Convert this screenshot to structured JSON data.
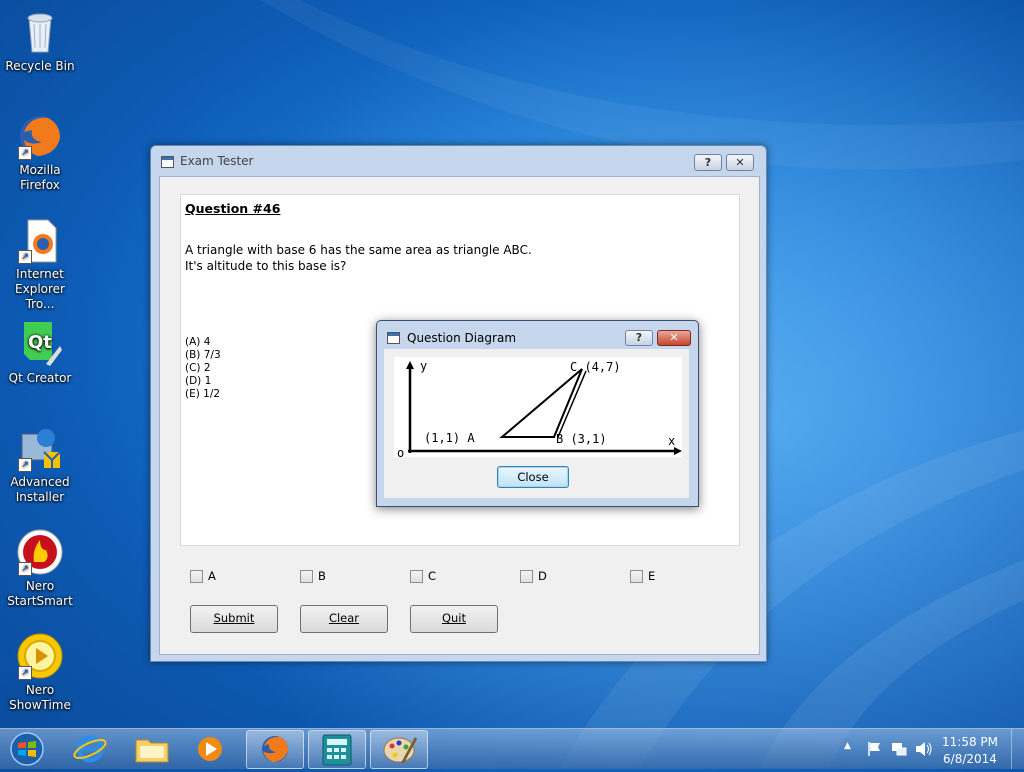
{
  "desktop": {
    "icons": [
      {
        "label": "Recycle Bin",
        "icon": "recycle-bin-icon"
      },
      {
        "label": "Mozilla\nFirefox",
        "icon": "firefox-icon"
      },
      {
        "label": "Internet\nExplorer Tro...",
        "icon": "ie-troubleshooter-icon"
      },
      {
        "label": "Qt Creator",
        "icon": "qt-creator-icon"
      },
      {
        "label": "Advanced\nInstaller",
        "icon": "advanced-installer-icon"
      },
      {
        "label": "Nero\nStartSmart",
        "icon": "nero-startsmart-icon"
      },
      {
        "label": "Nero\nShowTime",
        "icon": "nero-showtime-icon"
      }
    ]
  },
  "window": {
    "title": "Exam Tester",
    "help_label": "?",
    "close_label": "✕",
    "question": {
      "title": "Question #46",
      "line1": "A triangle with base 6 has the same area as triangle ABC.",
      "line2": "It's altitude to this base is?",
      "options": [
        "(A) 4",
        "(B) 7/3",
        "(C) 2",
        "(D) 1",
        "(E) 1/2"
      ]
    },
    "checkboxes": [
      "A",
      "B",
      "C",
      "D",
      "E"
    ],
    "buttons": {
      "submit": "Submit",
      "clear": "Clear",
      "quit": "Quit"
    }
  },
  "dialog": {
    "title": "Question Diagram",
    "help_label": "?",
    "close_x": "✕",
    "close_button": "Close",
    "diagram": {
      "y_label": "y",
      "x_label": "x",
      "origin_label": "o",
      "point_a": "(1,1) A",
      "point_b": "B (3,1)",
      "point_c": "C (4,7)"
    }
  },
  "taskbar": {
    "time": "11:58 PM",
    "date": "6/8/2014",
    "tray_chevron": "▲"
  }
}
